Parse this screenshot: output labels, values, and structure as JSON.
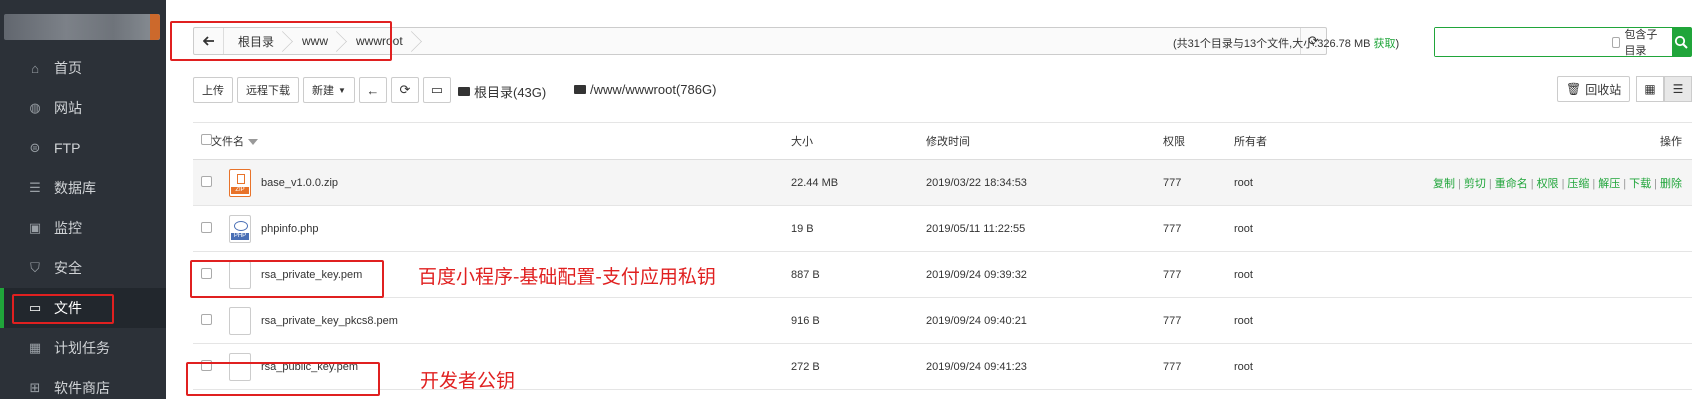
{
  "sidebar": {
    "items": [
      {
        "label": "首页",
        "icon": "home-icon"
      },
      {
        "label": "网站",
        "icon": "globe-icon"
      },
      {
        "label": "FTP",
        "icon": "ftp-icon"
      },
      {
        "label": "数据库",
        "icon": "database-icon"
      },
      {
        "label": "监控",
        "icon": "monitor-icon"
      },
      {
        "label": "安全",
        "icon": "shield-icon"
      },
      {
        "label": "文件",
        "icon": "folder-icon",
        "active": true
      },
      {
        "label": "计划任务",
        "icon": "calendar-icon"
      },
      {
        "label": "软件商店",
        "icon": "apps-icon"
      }
    ]
  },
  "pathbar": {
    "crumbs": [
      "根目录",
      "www",
      "wwwroot"
    ]
  },
  "summary": {
    "text": "(共31个目录与13个文件,大小:326.78 MB ",
    "link": "获取",
    "close": ")"
  },
  "search": {
    "placeholder": "",
    "subdir_label": "包含子目录"
  },
  "toolbar": {
    "upload": "上传",
    "remote_download": "远程下载",
    "new": "新建",
    "disk_root": "根目录(43G)",
    "disk_path": "/www/wwwroot(786G)",
    "recycle": "回收站"
  },
  "table": {
    "headers": {
      "name": "文件名",
      "size": "大小",
      "mtime": "修改时间",
      "perm": "权限",
      "owner": "所有者",
      "ops": "操作"
    },
    "rows": [
      {
        "name": "base_v1.0.0.zip",
        "size": "22.44 MB",
        "mtime": "2019/03/22 18:34:53",
        "perm": "777",
        "owner": "root",
        "type": "zip"
      },
      {
        "name": "phpinfo.php",
        "size": "19 B",
        "mtime": "2019/05/11 11:22:55",
        "perm": "777",
        "owner": "root",
        "type": "php"
      },
      {
        "name": "rsa_private_key.pem",
        "size": "887 B",
        "mtime": "2019/09/24 09:39:32",
        "perm": "777",
        "owner": "root",
        "type": "file"
      },
      {
        "name": "rsa_private_key_pkcs8.pem",
        "size": "916 B",
        "mtime": "2019/09/24 09:40:21",
        "perm": "777",
        "owner": "root",
        "type": "file"
      },
      {
        "name": "rsa_public_key.pem",
        "size": "272 B",
        "mtime": "2019/09/24 09:41:23",
        "perm": "777",
        "owner": "root",
        "type": "file"
      }
    ],
    "ops": [
      "复制",
      "剪切",
      "重命名",
      "权限",
      "压缩",
      "解压",
      "下载",
      "删除"
    ]
  },
  "annotations": {
    "private_key_note": "百度小程序-基础配置-支付应用私钥",
    "public_key_note": "开发者公钥"
  },
  "colors": {
    "accent": "#20a53a",
    "annotation": "#e02020",
    "sidebar_bg": "#2c3138"
  }
}
